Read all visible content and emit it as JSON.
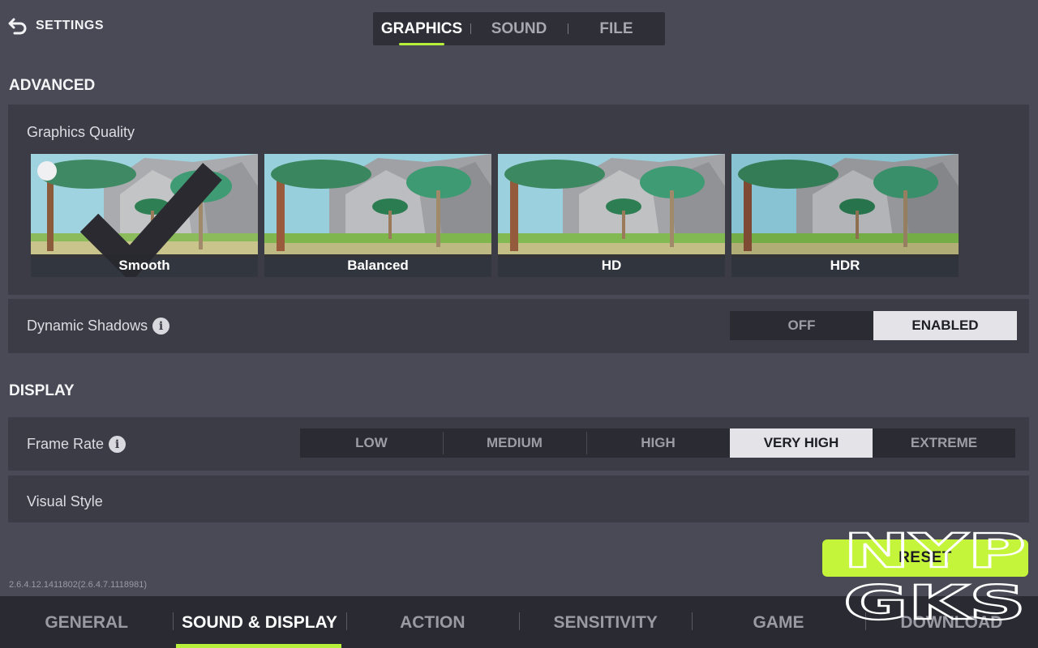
{
  "header": {
    "back_label": "SETTINGS",
    "tabs": [
      {
        "label": "GRAPHICS",
        "active": true
      },
      {
        "label": "SOUND",
        "active": false
      },
      {
        "label": "FILE",
        "active": false
      }
    ]
  },
  "advanced": {
    "title": "ADVANCED",
    "graphics_quality": {
      "label": "Graphics Quality",
      "options": [
        {
          "label": "Smooth",
          "selected": true
        },
        {
          "label": "Balanced",
          "selected": false
        },
        {
          "label": "HD",
          "selected": false
        },
        {
          "label": "HDR",
          "selected": false
        }
      ]
    },
    "dynamic_shadows": {
      "label": "Dynamic Shadows",
      "options": [
        {
          "label": "OFF",
          "active": false
        },
        {
          "label": "ENABLED",
          "active": true
        }
      ]
    }
  },
  "display": {
    "title": "DISPLAY",
    "frame_rate": {
      "label": "Frame Rate",
      "options": [
        {
          "label": "LOW",
          "active": false
        },
        {
          "label": "MEDIUM",
          "active": false
        },
        {
          "label": "HIGH",
          "active": false
        },
        {
          "label": "VERY HIGH",
          "active": true
        },
        {
          "label": "EXTREME",
          "active": false
        }
      ]
    },
    "visual_style": {
      "label": "Visual Style"
    }
  },
  "version": "2.6.4.12.1411802(2.6.4.7.1118981)",
  "reset_label": "RESET",
  "bottom_nav": [
    {
      "label": "GENERAL",
      "active": false
    },
    {
      "label": "SOUND & DISPLAY",
      "active": true
    },
    {
      "label": "ACTION",
      "active": false
    },
    {
      "label": "SENSITIVITY",
      "active": false
    },
    {
      "label": "GAME",
      "active": false
    },
    {
      "label": "DOWNLOAD",
      "active": false
    }
  ],
  "watermark": {
    "line1": "NYP",
    "line2": "GKS"
  },
  "colors": {
    "accent": "#b7f03a",
    "reset": "#c4f53a",
    "background": "#4a4a56",
    "panel": "#3c3c47",
    "segment_bg": "#2b2b33",
    "segment_active": "#e3e3e8"
  },
  "icons": {
    "back": "back-arrow-icon",
    "info": "info-icon",
    "check": "check-icon"
  }
}
